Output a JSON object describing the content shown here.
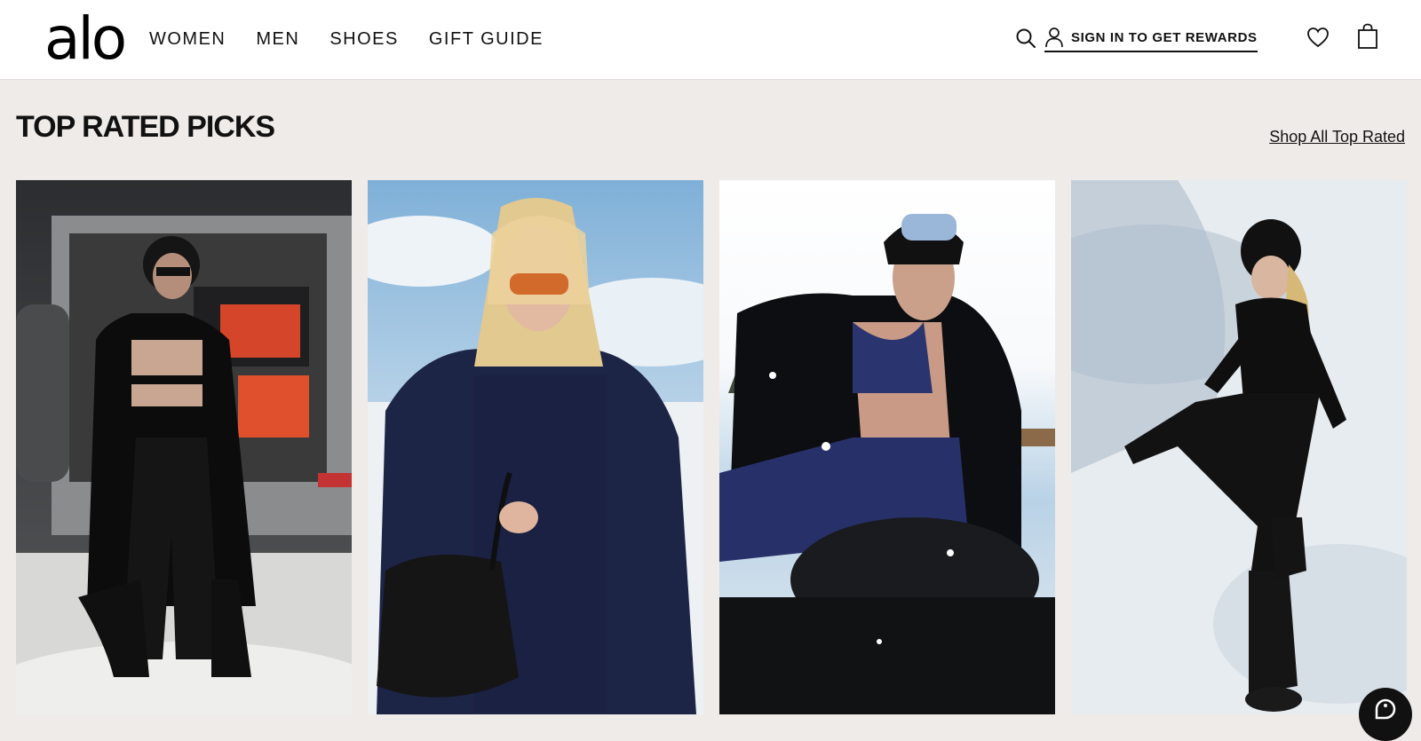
{
  "brand": {
    "logo_text": "alo"
  },
  "nav": {
    "items": [
      {
        "label": "WOMEN"
      },
      {
        "label": "MEN"
      },
      {
        "label": "SHOES"
      },
      {
        "label": "GIFT GUIDE"
      }
    ]
  },
  "header_tools": {
    "search_icon": "search-icon",
    "signin_label": "SIGN IN TO GET REWARDS",
    "wishlist_icon": "heart-icon",
    "bag_icon": "shopping-bag-icon"
  },
  "section": {
    "title": "TOP RATED PICKS",
    "shop_link": "Shop All Top Rated"
  },
  "products": [
    {
      "image": "model-with-suv-black-fur-coat"
    },
    {
      "image": "blonde-model-navy-fleece-duffle-bag"
    },
    {
      "image": "model-ski-goggles-navy-bra"
    },
    {
      "image": "model-lying-in-snow-black-outfit"
    }
  ],
  "colors": {
    "header_bg": "#ffffff",
    "page_bg": "#efebe8",
    "text": "#111111"
  }
}
